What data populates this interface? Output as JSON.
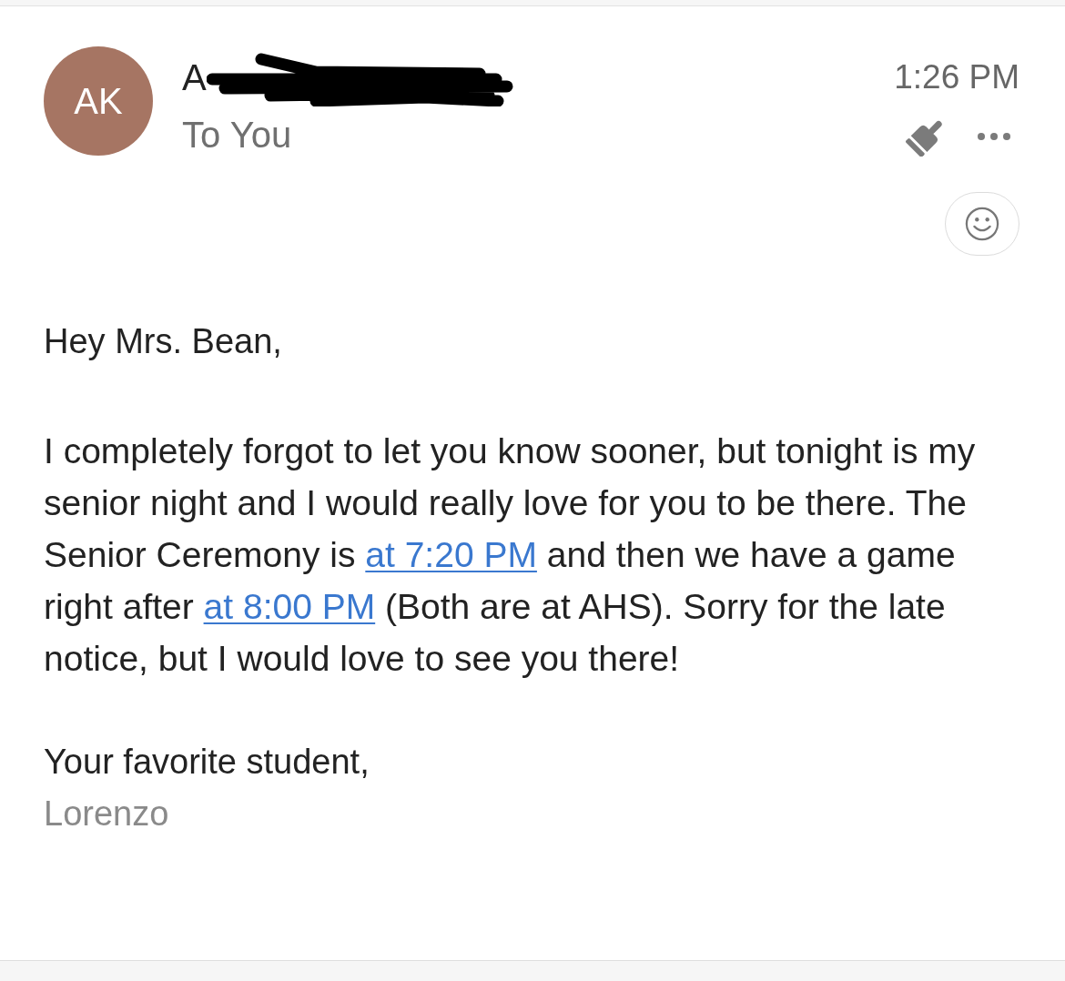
{
  "header": {
    "avatar_initials": "AK",
    "sender": "A",
    "recipient": "To You",
    "time": "1:26 PM"
  },
  "body": {
    "greeting": "Hey Mrs. Bean,",
    "paragraph": [
      {
        "kind": "text",
        "text": "I completely forgot to let you know sooner, but tonight is my senior night and I would really love for you to be there. The Senior Ceremony is "
      },
      {
        "kind": "link",
        "text": "at 7:20 PM"
      },
      {
        "kind": "text",
        "text": " and then we have a game right after "
      },
      {
        "kind": "link",
        "text": "at 8:00 PM"
      },
      {
        "kind": "text",
        "text": " (Both are at AHS). Sorry for the late notice, but I would love to see you there!"
      }
    ],
    "closing": "Your favorite student,",
    "signature": "Lorenzo"
  }
}
